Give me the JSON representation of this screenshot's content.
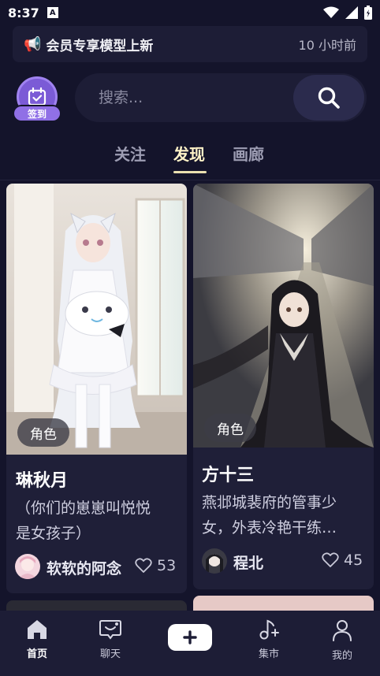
{
  "status": {
    "time": "8:37",
    "a_icon": "A"
  },
  "announcement": {
    "text": "会员专享模型上新",
    "time": "10 小时前"
  },
  "checkin": {
    "label": "签到"
  },
  "search": {
    "placeholder": "搜索..."
  },
  "tabs": [
    {
      "label": "关注",
      "active": false
    },
    {
      "label": "发现",
      "active": true
    },
    {
      "label": "画廊",
      "active": false
    }
  ],
  "cards": [
    {
      "tag": "角色",
      "title": "琳秋月",
      "desc_line1": "（你们的崽崽叫悦悦",
      "desc_line2": "是女孩子）",
      "author": "软软的阿念",
      "likes": "53"
    },
    {
      "tag": "角色",
      "title": "方十三",
      "desc_line1": "燕邶城裴府的管事少",
      "desc_line2": "女，外表冷艳干练…",
      "author": "程北",
      "likes": "45"
    }
  ],
  "nav": [
    {
      "label": "首页",
      "icon": "home-icon",
      "active": true
    },
    {
      "label": "聊天",
      "icon": "chat-icon",
      "active": false
    },
    {
      "label": "集市",
      "icon": "music-plus-icon",
      "active": false
    },
    {
      "label": "我的",
      "icon": "profile-icon",
      "active": false
    }
  ],
  "colors": {
    "accent": "#9070e6",
    "background": "#14142b",
    "card": "#1f1f38"
  }
}
